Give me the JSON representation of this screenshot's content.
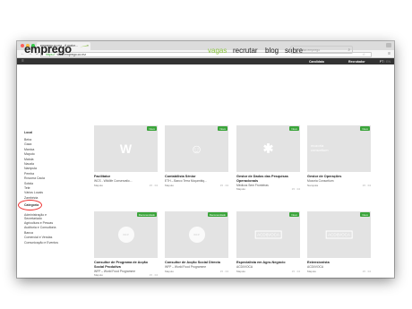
{
  "browser": {
    "tab_title": "emprego.co.mz - A maior…",
    "tab_close": "×",
    "url_protocol": "https://",
    "url_host": "www.emprego.co.mz",
    "nav_back": "←",
    "nav_forward": "→",
    "nav_reload": "↻",
    "star": "☆",
    "menu": "≡"
  },
  "topbar": {
    "left": "☰",
    "candidate": "Candidato",
    "recruiter": "Recrutador",
    "lang_active": "PT",
    "lang_sep": " / ",
    "lang_other": "EN"
  },
  "header": {
    "logo": "emprego",
    "nav": [
      "vagas",
      "recrutar",
      "blog",
      "sobre"
    ],
    "search_placeholder": "Pesquisa emprego",
    "search_icon": "⌕"
  },
  "sidebar": {
    "local_title": "Local",
    "local_items": [
      "Beira",
      "Gaza",
      "Manica",
      "Maputo",
      "Matola",
      "Nacala",
      "Nampula",
      "Pemba",
      "Rovuma Cacia",
      "Sofala",
      "Tete",
      "Vários Locais",
      "Zambézia"
    ],
    "category_title": "Categoria",
    "category_items": [
      "Administração e Secretariado",
      "Agricultura e Pescas",
      "Auditoria e Consultoria",
      "Banca",
      "Comercial e Vendas",
      "Comunicação e Eventos"
    ]
  },
  "cards": [
    {
      "title": "Facilitator",
      "company": "WCS - Wildlife Conservatio...",
      "location": "Maputo",
      "date": "15 · 04",
      "badge": "Novo",
      "thumb": "W"
    },
    {
      "title": "Contabilista Sénior",
      "company": "ETH – Banco Terra Moçambiq...",
      "location": "Maputo",
      "date": "15 · 04",
      "badge": "Novo",
      "thumb": "☺"
    },
    {
      "title": "Gestor de Dados das Pesquisas Operacionais",
      "company": "Médicos Sem Fronteiras",
      "location": "Maputo",
      "date": "15 · 04",
      "badge": "Novo",
      "thumb": "✱"
    },
    {
      "title": "Gestor de Operações",
      "company": "Mozoria Consortium",
      "location": "Nampula",
      "date": "15 · 04",
      "badge": "Novo",
      "thumb": "mozoria consortium"
    },
    {
      "title": "Consultor de Programa de Acção Social Produtiva",
      "company": "WFP – World Food Programme",
      "location": "Maputo",
      "date": "15 · 04",
      "badge": "Recomendado",
      "thumb": "WFP"
    },
    {
      "title": "Consultor de Acção Social Directa",
      "company": "WFP – World Food Programme",
      "location": "Maputo",
      "date": "15 · 04",
      "badge": "Recomendado",
      "thumb": "WFP"
    },
    {
      "title": "Especialista em Agro-Negócio",
      "company": "ACDI/VOCA",
      "location": "Maputo",
      "date": "15 · 04",
      "badge": "Novo",
      "thumb": "ACDI|VOCA"
    },
    {
      "title": "Extensionista",
      "company": "ACDI/VOCA",
      "location": "Maputo",
      "date": "15 · 04",
      "badge": "Novo",
      "thumb": "ACDI|VOCA"
    }
  ],
  "colors": {
    "brand_green": "#8cc63f",
    "badge_green": "#3aa43a",
    "topbar": "#333333",
    "annotation_circle": "#e33333"
  }
}
